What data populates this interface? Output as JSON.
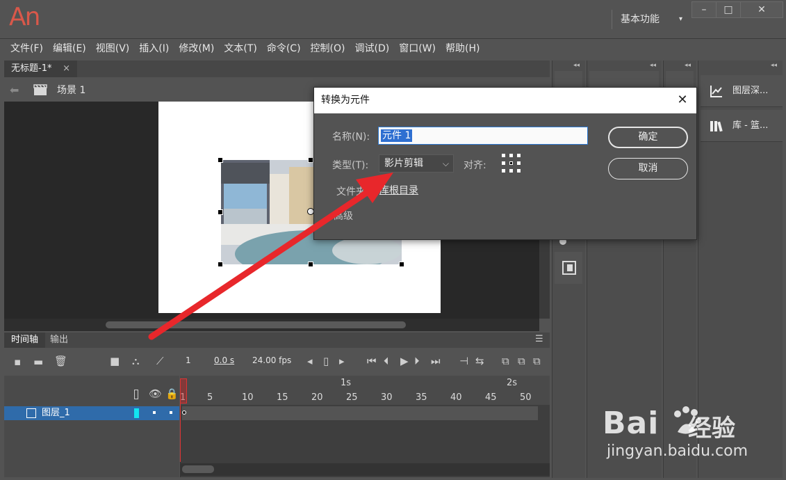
{
  "app": {
    "logo": "An"
  },
  "workspace": {
    "label": "基本功能"
  },
  "menu": [
    "文件(F)",
    "编辑(E)",
    "视图(V)",
    "插入(I)",
    "修改(M)",
    "文本(T)",
    "命令(C)",
    "控制(O)",
    "调试(D)",
    "窗口(W)",
    "帮助(H)"
  ],
  "document_tab": {
    "title": "无标题-1*",
    "close": "×"
  },
  "scene": {
    "label": "场景 1"
  },
  "right_panels": [
    {
      "label": "图层深..."
    },
    {
      "label": "库 - 篮..."
    }
  ],
  "dialog": {
    "title": "转换为元件",
    "name_label": "名称(N):",
    "name_value": "元件 1",
    "type_label": "类型(T):",
    "type_value": "影片剪辑",
    "align_label": "对齐:",
    "folder_label": "文件夹:",
    "folder_value": "库根目录",
    "advanced_label": "高级",
    "ok_label": "确定",
    "cancel_label": "取消"
  },
  "timeline": {
    "tabs": [
      "时间轴",
      "输出"
    ],
    "current_frame": "1",
    "time": "0.0 s",
    "fps": "24.00 fps",
    "ruler_seconds": [
      "1s",
      "2s"
    ],
    "ruler_frames": [
      "1",
      "5",
      "10",
      "15",
      "20",
      "25",
      "30",
      "35",
      "40",
      "45",
      "50"
    ],
    "layer_name": "图层_1"
  },
  "watermark": {
    "brand": "Bai",
    "brand2": "经验",
    "url": "jingyan.baidu.com"
  },
  "colors": {
    "accent": "#2e6fd1",
    "arrow": "#e8272b",
    "logo": "#d9584a",
    "layer_highlight": "#2f6baa"
  }
}
